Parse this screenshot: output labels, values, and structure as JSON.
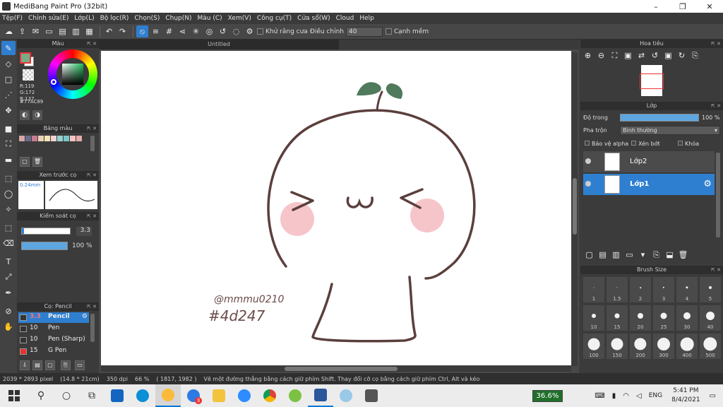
{
  "window": {
    "title": "MediBang Paint Pro (32bit)",
    "minimize": "–",
    "restore": "❐",
    "close": "✕"
  },
  "menu": [
    "Tệp(F)",
    "Chỉnh sửa(E)",
    "Lớp(L)",
    "Bộ lọc(R)",
    "Chọn(S)",
    "Chụp(N)",
    "Màu (C)",
    "Xem(V)",
    "Công cụ(T)",
    "Cửa sổ(W)",
    "Cloud",
    "Help"
  ],
  "toolbar": {
    "antialias_label": "Khử răng cưa",
    "adjust_label": "Điều chỉnh",
    "adjust_value": "40",
    "smooth_label": "Cạnh mềm"
  },
  "color_panel": {
    "title": "Màu",
    "r": "R:119",
    "g": "G:172",
    "b": "B:137",
    "hex": "#77AC89",
    "fg_color": "#77ac89"
  },
  "palette_panel": {
    "title": "Bảng màu",
    "swatches": [
      "#d7a6a6",
      "#6b6b8b",
      "#c87b92",
      "#e9d2b6",
      "#f5e5b5",
      "#f1d3d3",
      "#98d0d0",
      "#7cc6c6",
      "#f5c4c4",
      "#e8aaaa"
    ]
  },
  "brush_preview": {
    "title": "Xem trước cọ",
    "size_text": "0.24mm"
  },
  "brush_control": {
    "title": "Kiểm soát cọ",
    "size_value": "3.3",
    "opacity_value": "100 %",
    "opacity_level": 1.0
  },
  "brush_list": {
    "title": "Cọ: Pencil",
    "items": [
      {
        "size": "3.3",
        "name": "Pencil",
        "color": "#333333"
      },
      {
        "size": "10",
        "name": "Pen",
        "color": "#333333"
      },
      {
        "size": "10",
        "name": "Pen (Sharp)",
        "color": "#333333"
      },
      {
        "size": "15",
        "name": "G Pen",
        "color": "#e83030"
      }
    ]
  },
  "document": {
    "tab_title": "Untitled"
  },
  "artwork": {
    "signature": "@mmmu0210",
    "hashtag": "#4d247"
  },
  "navigator": {
    "title": "Hoa tiêu"
  },
  "layer_panel": {
    "title": "Lớp",
    "opacity_label": "Độ trong",
    "opacity_value": "100 %",
    "opacity_level": 1.0,
    "blend_label": "Pha trộn",
    "blend_value": "Bình thường",
    "protect_alpha": "Bảo vệ alpha",
    "clipping": "Xén bớt",
    "lock": "Khóa",
    "layers": [
      {
        "name": "Lớp2",
        "selected": false
      },
      {
        "name": "Lớp1",
        "selected": true
      }
    ]
  },
  "brush_size": {
    "title": "Brush Size",
    "sizes": [
      "1",
      "1.5",
      "2",
      "3",
      "4",
      "5",
      "10",
      "15",
      "20",
      "25",
      "30",
      "40",
      "100",
      "150",
      "200",
      "300",
      "400",
      "500"
    ]
  },
  "status": {
    "dimensions": "2039 * 2893 pixel",
    "physical": "(14.8 * 21cm)",
    "dpi": "350 dpi",
    "zoom": "66 %",
    "coords": "( 1817, 1982 )",
    "hint": "Vẽ một đường thẳng bằng cách giữ phím Shift. Thay đổi cỡ cọ bằng cách giữ phím Ctrl, Alt và kéo"
  },
  "taskbar": {
    "battery_pct": "36.6%",
    "lang": "ENG",
    "time": "5:41 PM",
    "date": "8/4/2021",
    "badge": "3"
  }
}
